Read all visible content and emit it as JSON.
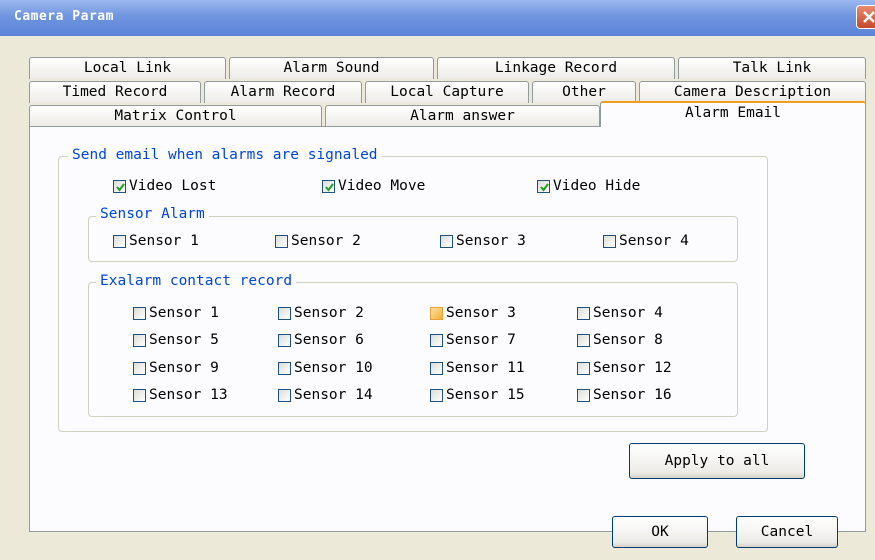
{
  "window": {
    "title": "Camera Param"
  },
  "tabs": {
    "row1": [
      "Local Link",
      "Alarm Sound",
      "Linkage Record",
      "Talk Link"
    ],
    "row2": [
      "Timed Record",
      "Alarm Record",
      "Local Capture",
      "Other",
      "Camera Description"
    ],
    "row3": [
      "Matrix Control",
      "Alarm answer",
      "Alarm Email"
    ],
    "active": "Alarm Email"
  },
  "email_group": {
    "legend": "Send email when alarms are signaled",
    "options": [
      {
        "label": "Video Lost",
        "checked": true
      },
      {
        "label": "Video Move",
        "checked": true
      },
      {
        "label": "Video Hide",
        "checked": true
      }
    ]
  },
  "sensor_alarm": {
    "legend": "Sensor Alarm",
    "sensors": [
      "Sensor 1",
      "Sensor 2",
      "Sensor 3",
      "Sensor 4"
    ]
  },
  "exalarm": {
    "legend": "Exalarm contact record",
    "sensors": [
      "Sensor 1",
      "Sensor 2",
      "Sensor 3",
      "Sensor 4",
      "Sensor 5",
      "Sensor 6",
      "Sensor 7",
      "Sensor 8",
      "Sensor 9",
      "Sensor 10",
      "Sensor 11",
      "Sensor 12",
      "Sensor 13",
      "Sensor 14",
      "Sensor 15",
      "Sensor 16"
    ]
  },
  "buttons": {
    "apply_all": "Apply to all",
    "ok": "OK",
    "cancel": "Cancel"
  }
}
